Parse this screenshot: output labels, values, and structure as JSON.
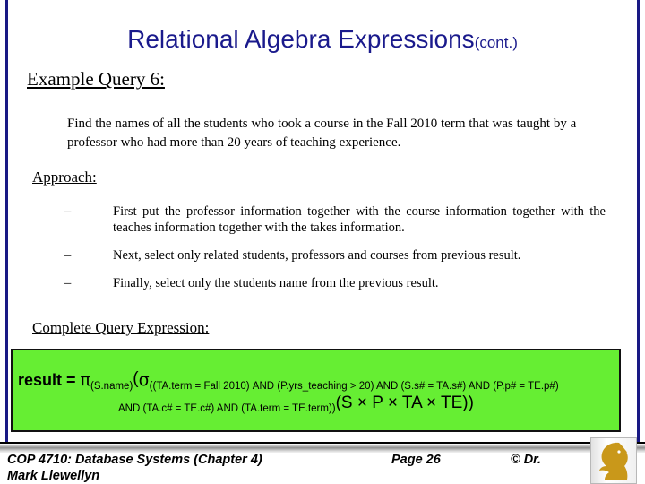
{
  "slide": {
    "title_main": "Relational Algebra Expressions",
    "title_cont": "(cont.)",
    "example_heading": "Example Query 6:",
    "query_text": "Find the names of all the students who took a course in the Fall 2010 term that was taught by a professor who had more than 20 years of teaching experience.",
    "approach_heading": "Approach:",
    "bullets": [
      {
        "dash": "–",
        "text": "First put the professor information together with the course information together with the teaches information together with the takes information."
      },
      {
        "dash": "–",
        "text": "Next,  select only related students, professors and courses from previous result."
      },
      {
        "dash": "–",
        "text": "Finally, select only the students name from the previous result."
      }
    ],
    "complete_heading": "Complete Query Expression:"
  },
  "formula": {
    "lhs": "result = ",
    "pi": "π",
    "pi_sub": "(S.name)",
    "open_paren_1": "(",
    "sigma": "σ",
    "sigma_sub_line1": "((TA.term = Fall 2010) AND (P.yrs_teaching > 20) AND (S.s# = TA.s#) AND (P.p# = TE.p#)",
    "sigma_sub_line2": "AND  (TA.c# = TE.c#)  AND (TA.term = TE.term))",
    "cross_expr": "(S × P × TA × TE))",
    "box_color": "#66EE33",
    "border_color": "#111111"
  },
  "footer": {
    "course": "COP 4710: Database Systems  (Chapter 4)",
    "author": "Mark Llewellyn",
    "page": "Page 26",
    "copyright": "© Dr.",
    "logo_name": "ucf-pegasus-logo",
    "logo_color": "#C9981A"
  },
  "colors": {
    "title": "#1a1a8c",
    "edge_rule": "#181884",
    "body_text": "#000000"
  }
}
